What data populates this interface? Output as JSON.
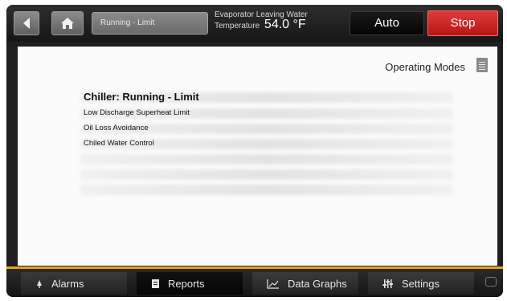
{
  "header": {
    "back_icon": "back-arrow-icon",
    "home_icon": "home-icon",
    "status_text": "Running - Limit",
    "evap_label_line1": "Evaporator Leaving Water",
    "evap_label_line2": "Temperature",
    "evap_value": "54.0 °F",
    "auto_label": "Auto",
    "stop_label": "Stop",
    "stop_color": "#c81e1e"
  },
  "main": {
    "operating_modes_label": "Operating Modes",
    "chiller_title": "Chiller:  Running - Limit",
    "mode_lines": [
      "Low Discharge Superheat Limit",
      "Oil Loss Avoidance",
      "Chiled Water Control"
    ]
  },
  "footer": {
    "accent_color": "#e8a21a",
    "tabs": [
      {
        "label": "Alarms",
        "icon": "bell-icon"
      },
      {
        "label": "Reports",
        "icon": "document-icon"
      },
      {
        "label": "Data Graphs",
        "icon": "graph-icon"
      },
      {
        "label": "Settings",
        "icon": "sliders-icon"
      }
    ],
    "active_tab": "Reports",
    "chat_icon": "chat-icon"
  }
}
